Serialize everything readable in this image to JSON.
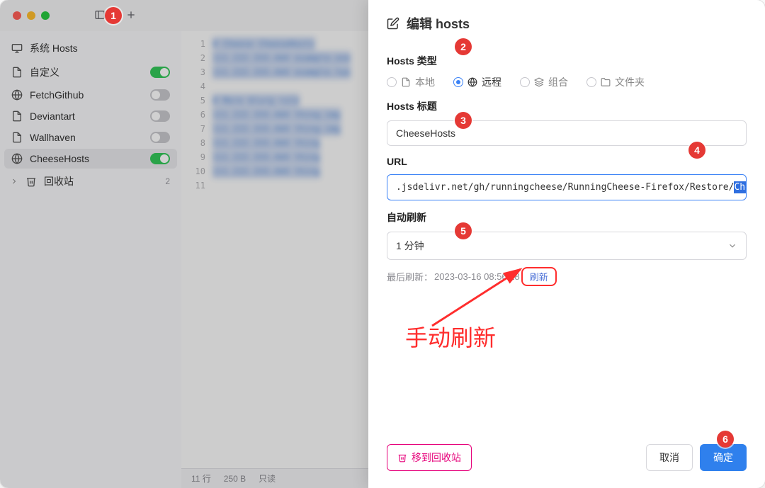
{
  "titlebar": {},
  "sidebar": {
    "items": [
      {
        "label": "系统 Hosts",
        "icon": "monitor"
      },
      {
        "label": "自定义",
        "icon": "file",
        "toggle": true
      },
      {
        "label": "FetchGithub",
        "icon": "globe",
        "toggle": false
      },
      {
        "label": "Deviantart",
        "icon": "file",
        "toggle": false
      },
      {
        "label": "Wallhaven",
        "icon": "file",
        "toggle": false
      },
      {
        "label": "CheeseHosts",
        "icon": "globe",
        "toggle": true
      }
    ],
    "trash_label": "回收站",
    "trash_count": "2"
  },
  "editor": {
    "blurred": [
      "# Cheese CheeseHosts",
      "111.222.333.444 example.one",
      "111.222.333.444 example.two",
      "",
      "# More blurg rule",
      "111.222.333.444 thing.img",
      "111.222.333.444 thing.img",
      "111.222.333.444 thing",
      "111.222.333.444 thing",
      "111.222.333.444 thing"
    ],
    "status_lines": "11 行",
    "status_bytes": "250 B",
    "status_mode": "只读"
  },
  "panel": {
    "title": "编辑 hosts",
    "type_label": "Hosts 类型",
    "types": {
      "local": "本地",
      "remote": "远程",
      "group": "组合",
      "folder": "文件夹"
    },
    "title_field_label": "Hosts 标题",
    "title_value": "CheeseHosts",
    "url_label": "URL",
    "url_prefix": ".jsdelivr.net/gh/runningcheese/RunningCheese-Firefox/Restore/",
    "url_selected": "CheeseHosts.txt",
    "auto_refresh_label": "自动刷新",
    "auto_refresh_value": "1 分钟",
    "last_refresh_label": "最后刷新：",
    "last_refresh_time": "2023-03-16 08:56:18",
    "refresh_now": "刷新",
    "trash_btn": "移到回收站",
    "cancel": "取消",
    "confirm": "确定"
  },
  "annotation": {
    "manual_refresh": "手动刷新"
  }
}
